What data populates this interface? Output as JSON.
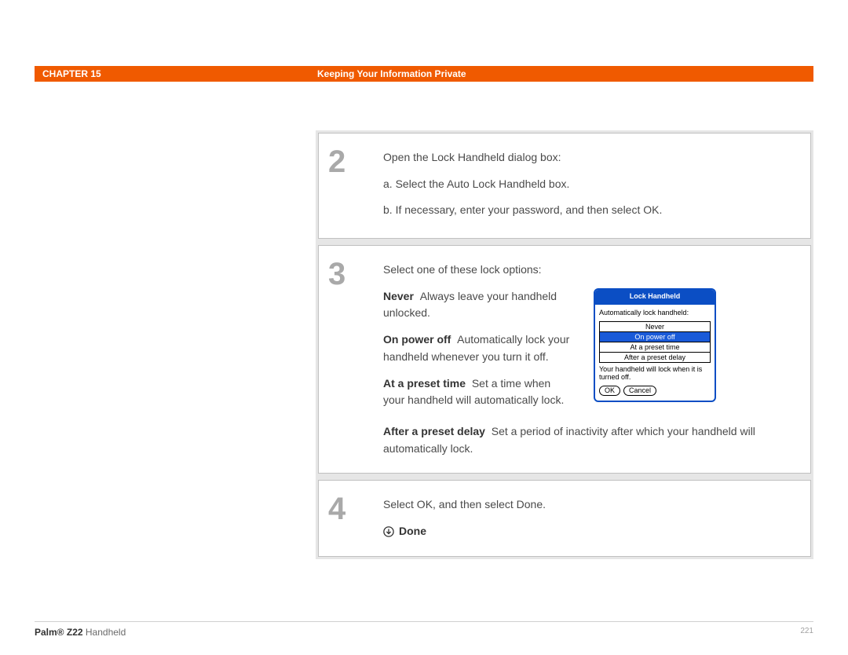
{
  "header": {
    "chapter": "CHAPTER 15",
    "title": "Keeping Your Information Private"
  },
  "steps": {
    "s2": {
      "num": "2",
      "intro": "Open the Lock Handheld dialog box:",
      "a": "a. Select the Auto Lock Handheld box.",
      "b": "b. If necessary, enter your password, and then select OK."
    },
    "s3": {
      "num": "3",
      "intro": "Select one of these lock options:",
      "never_term": "Never",
      "never_desc": "Always leave your handheld unlocked.",
      "poweroff_term": "On power off",
      "poweroff_desc": "Automatically lock your handheld whenever you turn it off.",
      "preset_term": "At a preset time",
      "preset_desc": "Set a time when your handheld will automatically lock.",
      "delay_term": "After a preset delay",
      "delay_desc": "Set a period of inactivity after which your handheld will automatically lock."
    },
    "s4": {
      "num": "4",
      "text": "Select OK, and then select Done.",
      "done_label": "Done"
    }
  },
  "dialog": {
    "title": "Lock Handheld",
    "label": "Automatically lock handheld:",
    "opt1": "Never",
    "opt2": "On power off",
    "opt3": "At a preset time",
    "opt4": "After a preset delay",
    "note": "Your handheld will lock when it is turned off.",
    "ok": "OK",
    "cancel": "Cancel"
  },
  "footer": {
    "brand_bold": "Palm® Z22",
    "brand_rest": " Handheld",
    "page": "221"
  }
}
